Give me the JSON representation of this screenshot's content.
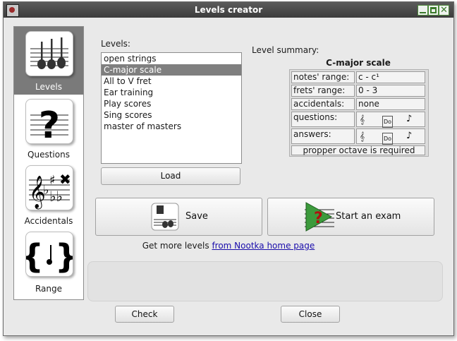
{
  "window": {
    "title": "Levels creator"
  },
  "sidebar": {
    "items": [
      {
        "label": "Levels",
        "icon": "guitars-icon"
      },
      {
        "label": "Questions",
        "icon": "question-mark-icon"
      },
      {
        "label": "Accidentals",
        "icon": "accidentals-icon"
      },
      {
        "label": "Range",
        "icon": "range-braces-icon"
      }
    ],
    "active": "Levels"
  },
  "levels": {
    "label": "Levels:",
    "items": [
      "open strings",
      "C-major scale",
      "All to V fret",
      "Ear training",
      "Play scores",
      "Sing scores",
      "master of masters"
    ],
    "selected": "C-major scale",
    "load_label": "Load"
  },
  "summary": {
    "label": "Level summary:",
    "title": "C-major scale",
    "rows": [
      {
        "key": "notes' range:",
        "value": "c - c¹"
      },
      {
        "key": "frets' range:",
        "value": "0 - 3"
      },
      {
        "key": "accidentals:",
        "value": "none"
      },
      {
        "key": "questions:",
        "value": ""
      },
      {
        "key": "answers:",
        "value": ""
      }
    ],
    "note_name_tag": "Do",
    "footer": "propper octave is required"
  },
  "actions": {
    "save_label": "Save",
    "exam_label": "Start an exam"
  },
  "more_levels": {
    "prefix": "Get more levels ",
    "link": "from Nootka home page"
  },
  "footer": {
    "check_label": "Check",
    "close_label": "Close"
  },
  "colors": {
    "titlebar": "#444444",
    "selection": "#7f7f7f",
    "link": "#1a0dab",
    "exam_arrow": "#3c9a3c"
  }
}
